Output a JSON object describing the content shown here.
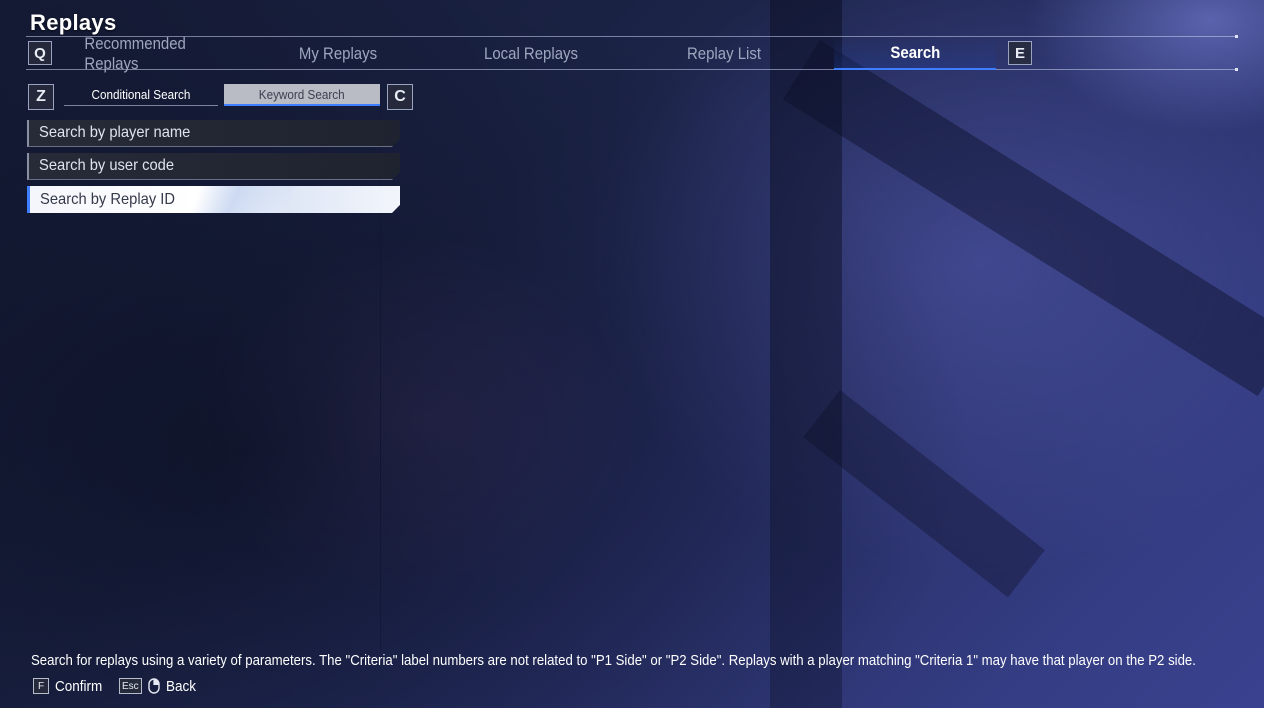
{
  "header": {
    "title": "Replays"
  },
  "tabs": {
    "prev_key": "Q",
    "next_key": "E",
    "items": [
      {
        "label": "Recommended Replays",
        "active": false
      },
      {
        "label": "My Replays",
        "active": false
      },
      {
        "label": "Local Replays",
        "active": false
      },
      {
        "label": "Replay List",
        "active": false
      },
      {
        "label": "Search",
        "active": true
      }
    ]
  },
  "subtabs": {
    "prev_key": "Z",
    "next_key": "C",
    "items": [
      {
        "label": "Conditional Search",
        "active": false
      },
      {
        "label": "Keyword Search",
        "active": true
      }
    ]
  },
  "search_fields": [
    {
      "label": "Search by player name",
      "selected": false
    },
    {
      "label": "Search by user code",
      "selected": false
    },
    {
      "label": "Search by Replay ID",
      "selected": true
    }
  ],
  "footer": {
    "description": "Search for replays using a variety of parameters. The \"Criteria\" label numbers are not related to \"P1 Side\" or \"P2 Side\". Replays with a player matching \"Criteria 1\" may have that player on the P2 side.",
    "hints": [
      {
        "key": "F",
        "label": "Confirm",
        "icon": "keyboard-key-f"
      },
      {
        "key": "Esc",
        "label": "Back",
        "icon": "mouse-icon"
      }
    ]
  },
  "colors": {
    "accent": "#3f7fff",
    "background": "#1b2346",
    "selected_field": "#ffffff"
  }
}
